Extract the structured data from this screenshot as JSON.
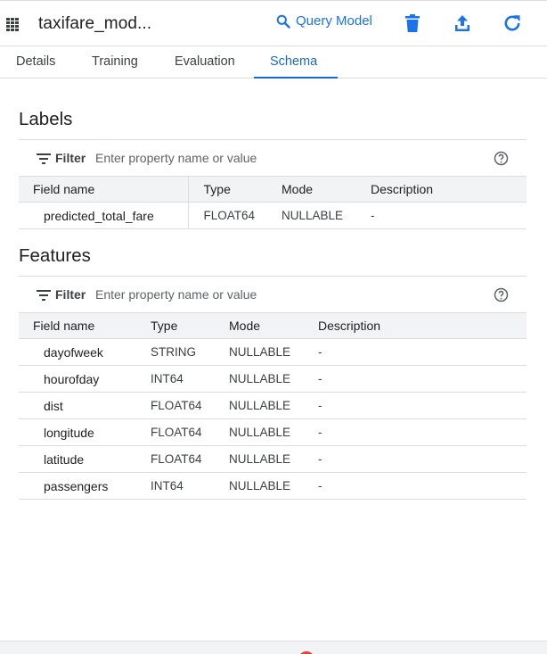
{
  "header": {
    "title": "taxifare_mod...",
    "query_label": "Query Model"
  },
  "tabs": [
    {
      "label": "Details"
    },
    {
      "label": "Training"
    },
    {
      "label": "Evaluation"
    },
    {
      "label": "Schema",
      "active": true
    }
  ],
  "labels_section": {
    "title": "Labels",
    "filter_label": "Filter",
    "filter_placeholder": "Enter property name or value",
    "columns": [
      "Field name",
      "Type",
      "Mode",
      "Description"
    ],
    "rows": [
      {
        "field": "predicted_total_fare",
        "type": "FLOAT64",
        "mode": "NULLABLE",
        "description": "-"
      }
    ]
  },
  "features_section": {
    "title": "Features",
    "filter_label": "Filter",
    "filter_placeholder": "Enter property name or value",
    "columns": [
      "Field name",
      "Type",
      "Mode",
      "Description"
    ],
    "rows": [
      {
        "field": "dayofweek",
        "type": "STRING",
        "mode": "NULLABLE",
        "description": "-"
      },
      {
        "field": "hourofday",
        "type": "INT64",
        "mode": "NULLABLE",
        "description": "-"
      },
      {
        "field": "dist",
        "type": "FLOAT64",
        "mode": "NULLABLE",
        "description": "-"
      },
      {
        "field": "longitude",
        "type": "FLOAT64",
        "mode": "NULLABLE",
        "description": "-"
      },
      {
        "field": "latitude",
        "type": "FLOAT64",
        "mode": "NULLABLE",
        "description": "-"
      },
      {
        "field": "passengers",
        "type": "INT64",
        "mode": "NULLABLE",
        "description": "-"
      }
    ]
  },
  "colors": {
    "accent": "#1a73e8",
    "header_bg": "#f1f3f4",
    "divider": "#dadce0"
  },
  "icons": {
    "model": "model-grid-icon",
    "query": "search-icon",
    "delete": "trash-icon",
    "export": "upload-icon",
    "refresh": "refresh-icon",
    "filter": "filter-lines-icon",
    "help": "help-circle-icon"
  }
}
